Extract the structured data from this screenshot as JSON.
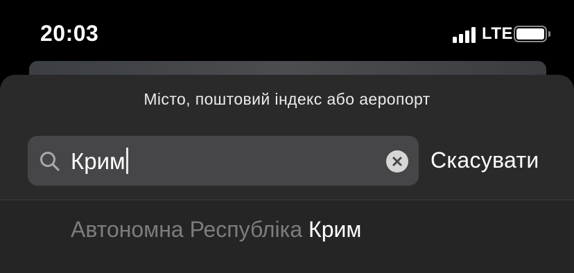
{
  "status_bar": {
    "time": "20:03",
    "network": "LTE",
    "signal_bars": 4,
    "battery_level": 1.0
  },
  "sheet": {
    "prompt": "Місто, поштовий індекс або аеропорт",
    "search": {
      "value": "Крим",
      "icon": "search-icon",
      "clear_icon": "clear-icon"
    },
    "cancel_label": "Скасувати"
  },
  "results": [
    {
      "prefix": "Автономна Республіка ",
      "match": "Крим"
    }
  ],
  "colors": {
    "background": "#000000",
    "sheet": "#2a2a2b",
    "field": "#464648",
    "muted_text": "#7d7d80",
    "text": "#ffffff"
  }
}
